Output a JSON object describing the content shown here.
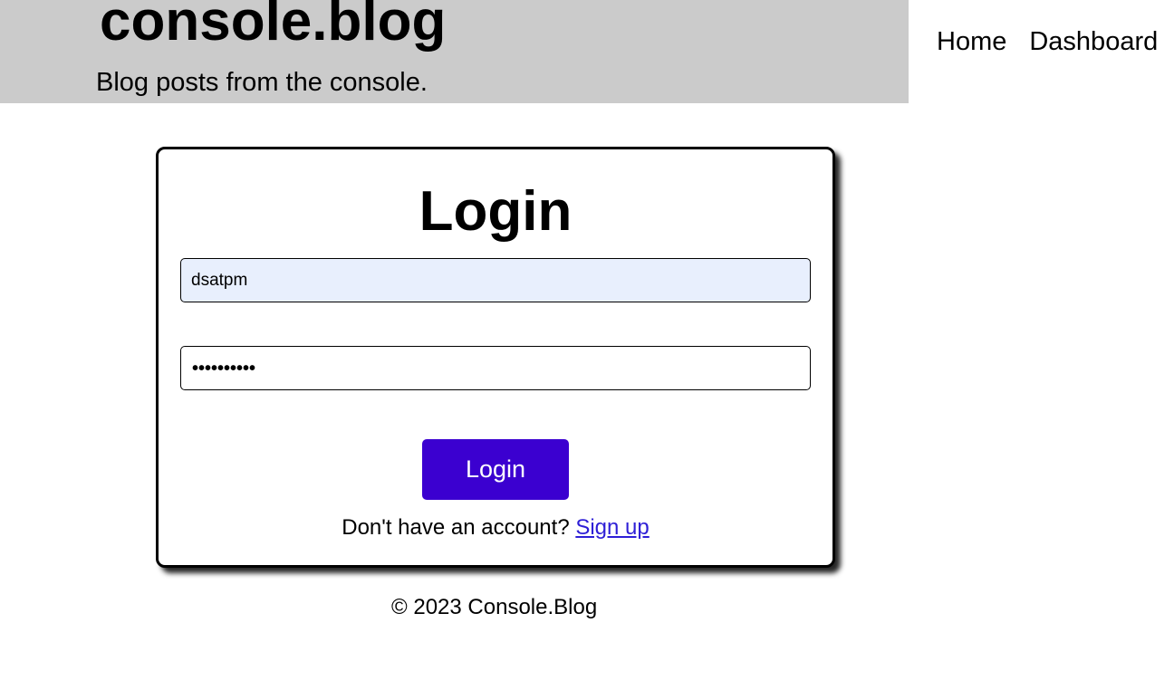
{
  "header": {
    "title": "console.blog",
    "tagline": "Blog posts from the console."
  },
  "nav": {
    "home": "Home",
    "dashboard": "Dashboard"
  },
  "login": {
    "title": "Login",
    "username_value": "dsatpm",
    "password_masked": "••••••••••",
    "button_label": "Login",
    "signup_prompt": "Don't have an account?",
    "signup_link": "Sign up"
  },
  "footer": {
    "copyright": "© 2023 Console.Blog"
  },
  "colors": {
    "header_bg": "#cbcbcb",
    "button_bg": "#3b00d0",
    "autofill_bg": "#e8effd",
    "link": "#2e1fd6"
  }
}
